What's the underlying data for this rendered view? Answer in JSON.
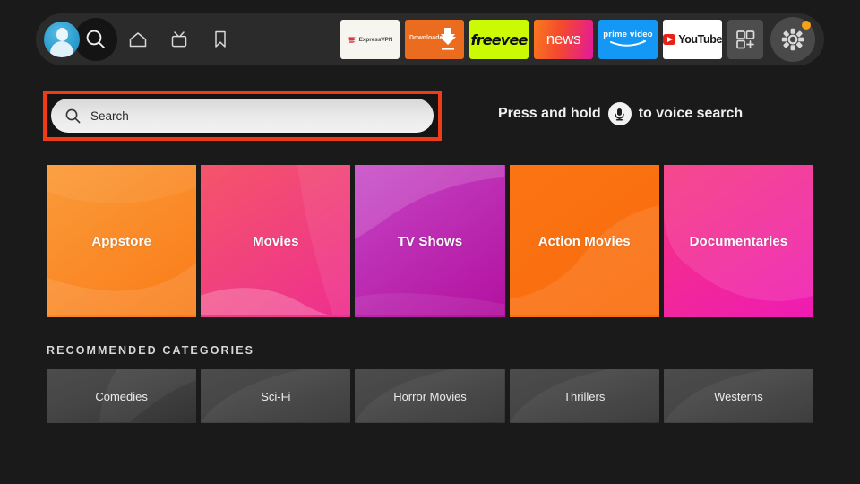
{
  "topbar": {
    "profile": {
      "name": "profile-avatar",
      "label": "Profile"
    },
    "search_button_label": "Search",
    "nav_icons": [
      {
        "name": "home-icon",
        "label": "Home"
      },
      {
        "name": "live-tv-icon",
        "label": "Live TV"
      },
      {
        "name": "bookmark-icon",
        "label": "Watchlist"
      }
    ],
    "apps": [
      {
        "name": "app-expressvpn",
        "label": "ExpressVPN",
        "bg": "#f7f5f0"
      },
      {
        "name": "app-downloader",
        "label": "Downloader",
        "bg": "#ec6c1f"
      },
      {
        "name": "app-freevee",
        "label": "freevee",
        "bg": "#ccfa05"
      },
      {
        "name": "app-news",
        "label": "news",
        "bg": "#f4482f"
      },
      {
        "name": "app-prime-video",
        "label": "prime video",
        "bg": "#1399f5"
      },
      {
        "name": "app-youtube",
        "label": "YouTube",
        "bg": "#ffffff"
      }
    ],
    "apps_grid_label": "All apps",
    "settings_label": "Settings",
    "settings_has_notification": true,
    "notification_color": "#f5a11a"
  },
  "search": {
    "placeholder": "Search",
    "highlight_color": "#ef3b18",
    "voice_hint_before": "Press and hold",
    "voice_hint_after": "to voice search",
    "mic_icon": "microphone-icon"
  },
  "features": {
    "tiles": [
      {
        "label": "Appstore",
        "c1": "#fb9b3a",
        "c2": "#f97b17",
        "wave": "#ff9a36"
      },
      {
        "label": "Movies",
        "c1": "#f4556a",
        "c2": "#ee2f8f",
        "wave": "#f8707f"
      },
      {
        "label": "TV Shows",
        "c1": "#c545c5",
        "c2": "#b2119f",
        "wave": "#bd32b8"
      },
      {
        "label": "Action Movies",
        "c1": "#fb7414",
        "c2": "#f96c0c",
        "wave": "#fd8526"
      },
      {
        "label": "Documentaries",
        "c1": "#f4357f",
        "c2": "#ef1bb3",
        "wave": "#f52f6e"
      }
    ]
  },
  "recommended": {
    "title": "RECOMMENDED CATEGORIES",
    "tiles": [
      {
        "label": "Comedies"
      },
      {
        "label": "Sci-Fi"
      },
      {
        "label": "Horror Movies"
      },
      {
        "label": "Thrillers"
      },
      {
        "label": "Westerns"
      }
    ]
  }
}
